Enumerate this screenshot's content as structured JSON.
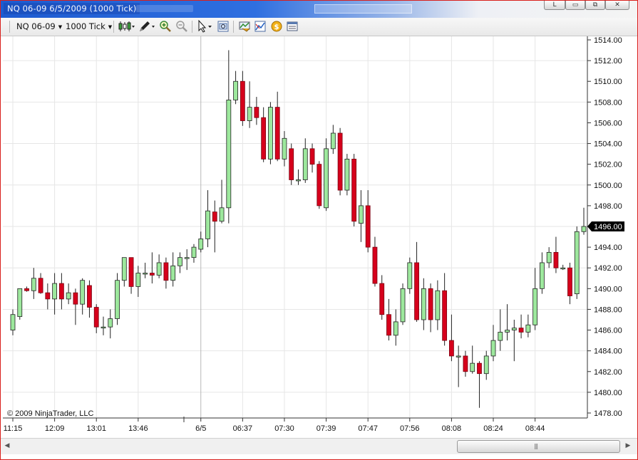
{
  "window": {
    "title": "NQ 06-09  6/5/2009 (1000 Tick)",
    "controls": [
      "L",
      "▭",
      "⧉",
      "✕"
    ]
  },
  "toolbar": {
    "instrument": "NQ 06-09",
    "interval": "1000 Tick",
    "icons": [
      "bar-type-icon",
      "draw-pencil-icon",
      "zoom-in-icon",
      "zoom-out-icon",
      "pointer-icon",
      "crosshair-icon",
      "data-box-icon",
      "indicators-icon",
      "strategies-icon",
      "properties-icon"
    ]
  },
  "chart_data": {
    "type": "candlestick",
    "copyright": "© 2009 NinjaTrader, LLC",
    "ylim": [
      1477,
      1515.5
    ],
    "y_ticks": [
      "1514.00",
      "1512.00",
      "1510.00",
      "1508.00",
      "1506.00",
      "1504.00",
      "1502.00",
      "1500.00",
      "1498.00",
      "1496.00",
      "1494.00",
      "1492.00",
      "1490.00",
      "1488.00",
      "1486.00",
      "1484.00",
      "1482.00",
      "1480.00",
      "1478.00"
    ],
    "x_labels": [
      "11:15",
      "12:09",
      "13:01",
      "13:46",
      "6/5",
      "06:37",
      "07:30",
      "07:39",
      "07:47",
      "07:56",
      "08:08",
      "08:24",
      "08:44"
    ],
    "last_price": "1496.00",
    "colors": {
      "up": "#9de89d",
      "down": "#d6001c",
      "wick": "#222222",
      "grid": "#e6e6e6",
      "price_tag": "#000000"
    },
    "candles": [
      [
        1486,
        1487.5,
        1485.5,
        1488
      ],
      [
        1487.3,
        1490,
        1487,
        1490
      ],
      [
        1490,
        1489.8,
        1489.7,
        1490.2
      ],
      [
        1489.8,
        1491,
        1489,
        1492
      ],
      [
        1491,
        1489.6,
        1489.5,
        1491.5
      ],
      [
        1489.6,
        1489,
        1488,
        1490.5
      ],
      [
        1489,
        1490.5,
        1487.5,
        1491.5
      ],
      [
        1490.5,
        1489,
        1488,
        1491.5
      ],
      [
        1489,
        1489.6,
        1488.5,
        1490.5
      ],
      [
        1489.6,
        1488.5,
        1486.5,
        1490
      ],
      [
        1488.5,
        1490.8,
        1487.5,
        1491
      ],
      [
        1490.3,
        1488.2,
        1487.2,
        1490.8
      ],
      [
        1488.2,
        1486.3,
        1485.7,
        1488.5
      ],
      [
        1486.3,
        1486.3,
        1485.5,
        1487.3
      ],
      [
        1486.3,
        1487.1,
        1485.2,
        1488
      ],
      [
        1487.1,
        1490.8,
        1486.5,
        1491.5
      ],
      [
        1490.8,
        1493,
        1490.2,
        1493
      ],
      [
        1493,
        1490.2,
        1489.5,
        1493
      ],
      [
        1490.2,
        1491.5,
        1489.2,
        1492.2
      ],
      [
        1491.5,
        1491.5,
        1491,
        1492.5
      ],
      [
        1491.5,
        1491.3,
        1490.5,
        1493.5
      ],
      [
        1491.3,
        1492.5,
        1491,
        1493.3
      ],
      [
        1492.5,
        1490.8,
        1490,
        1493
      ],
      [
        1490.8,
        1492.2,
        1490.2,
        1493.5
      ],
      [
        1492.2,
        1493,
        1491.5,
        1493.5
      ],
      [
        1493,
        1493,
        1491.8,
        1493.8
      ],
      [
        1493,
        1494,
        1492.5,
        1494.3
      ],
      [
        1493.8,
        1494.8,
        1493.5,
        1495.5
      ],
      [
        1494.8,
        1497.5,
        1494,
        1499.5
      ],
      [
        1497.4,
        1496.5,
        1493.5,
        1498.5
      ],
      [
        1496.5,
        1497.8,
        1496.3,
        1500.5
      ],
      [
        1497.8,
        1508.2,
        1496.3,
        1513
      ],
      [
        1508.2,
        1510,
        1507.8,
        1511
      ],
      [
        1510,
        1506.2,
        1505.7,
        1511
      ],
      [
        1506.2,
        1507.5,
        1505.5,
        1510
      ],
      [
        1507.5,
        1506.5,
        1505.8,
        1508.5
      ],
      [
        1506.5,
        1502.5,
        1502.2,
        1507.5
      ],
      [
        1502.5,
        1507.5,
        1502,
        1508
      ],
      [
        1507.5,
        1502.5,
        1502.3,
        1509
      ],
      [
        1502.5,
        1504.5,
        1501.8,
        1505.2
      ],
      [
        1503.5,
        1500.5,
        1500,
        1504
      ],
      [
        1500.5,
        1500.5,
        1500,
        1501.5
      ],
      [
        1500.5,
        1503.5,
        1500.2,
        1504.5
      ],
      [
        1503.5,
        1502,
        1501.2,
        1504
      ],
      [
        1502,
        1498,
        1497.7,
        1502.3
      ],
      [
        1497.8,
        1503.5,
        1497.5,
        1504.5
      ],
      [
        1503.5,
        1505,
        1503,
        1505.8
      ],
      [
        1505,
        1499.5,
        1499,
        1505.5
      ],
      [
        1499.5,
        1502.5,
        1499,
        1503
      ],
      [
        1502.5,
        1496.5,
        1496,
        1503
      ],
      [
        1496.3,
        1498,
        1494.5,
        1499.5
      ],
      [
        1498,
        1494,
        1493.5,
        1499.5
      ],
      [
        1494,
        1490.5,
        1490.2,
        1495
      ],
      [
        1490.5,
        1487.5,
        1487,
        1491.3
      ],
      [
        1487.5,
        1485.5,
        1485,
        1489
      ],
      [
        1485.5,
        1486.8,
        1484.5,
        1488
      ],
      [
        1486.8,
        1490,
        1486.5,
        1490.5
      ],
      [
        1490,
        1492.5,
        1489.5,
        1493
      ],
      [
        1492.5,
        1487,
        1486.8,
        1494.5
      ],
      [
        1487,
        1490,
        1486,
        1491
      ],
      [
        1490,
        1487,
        1485.8,
        1490.5
      ],
      [
        1487,
        1489.8,
        1486,
        1490.8
      ],
      [
        1489.8,
        1485,
        1484.5,
        1491.5
      ],
      [
        1485,
        1483.5,
        1483,
        1487.5
      ],
      [
        1483.5,
        1483.5,
        1480.5,
        1484.5
      ],
      [
        1483.5,
        1482,
        1481.5,
        1484
      ],
      [
        1482,
        1482.8,
        1481.8,
        1484.5
      ],
      [
        1482.8,
        1481.8,
        1478.5,
        1483
      ],
      [
        1481.8,
        1483.5,
        1481.2,
        1484
      ],
      [
        1483.5,
        1485,
        1483,
        1486.5
      ],
      [
        1485,
        1485.8,
        1484,
        1488
      ],
      [
        1485.8,
        1486,
        1485,
        1488.5
      ],
      [
        1486,
        1486.2,
        1483,
        1487
      ],
      [
        1486.2,
        1485.8,
        1485.2,
        1487.5
      ],
      [
        1485.8,
        1486.5,
        1485.3,
        1487.5
      ],
      [
        1486.5,
        1490,
        1486,
        1492
      ],
      [
        1490,
        1492.5,
        1489.5,
        1493.5
      ],
      [
        1492.5,
        1493.5,
        1492,
        1494
      ],
      [
        1493.5,
        1492,
        1491.5,
        1495
      ],
      [
        1492,
        1492,
        1491.8,
        1492.3
      ],
      [
        1492,
        1489.3,
        1488.5,
        1492.5
      ],
      [
        1489.5,
        1495.5,
        1489,
        1496
      ],
      [
        1495.5,
        1496,
        1495.2,
        1497.8
      ]
    ]
  }
}
